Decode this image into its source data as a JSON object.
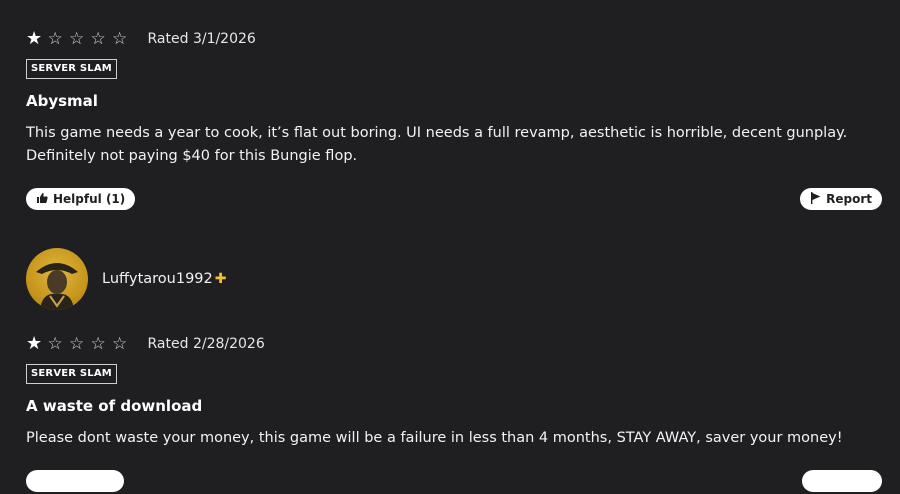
{
  "reviews": [
    {
      "stars_filled": 1,
      "stars_total": 5,
      "rated": "Rated 3/1/2026",
      "tag": "SERVER SLAM",
      "title": "Abysmal",
      "body": "This game needs a year to cook, it’s flat out boring. UI needs a full revamp, aesthetic is horrible, decent gunplay. Definitely not paying $40 for this Bungie flop.",
      "helpful": "Helpful (1)",
      "report": "Report"
    },
    {
      "username": "Luffytarou1992",
      "plus_icon": "ps-plus-icon",
      "stars_filled": 1,
      "stars_total": 5,
      "rated": "Rated 2/28/2026",
      "tag": "SERVER SLAM",
      "title": "A waste of download",
      "body": "Please dont waste your money, this game will be a failure in less than 4 months, STAY AWAY, saver your money!"
    }
  ],
  "icons": {
    "star": "star-icon",
    "thumbs_up": "thumbs-up-icon",
    "flag": "flag-icon"
  },
  "colors": {
    "background": "#1f1f22",
    "text": "#ffffff",
    "plus": "#f0c034"
  }
}
